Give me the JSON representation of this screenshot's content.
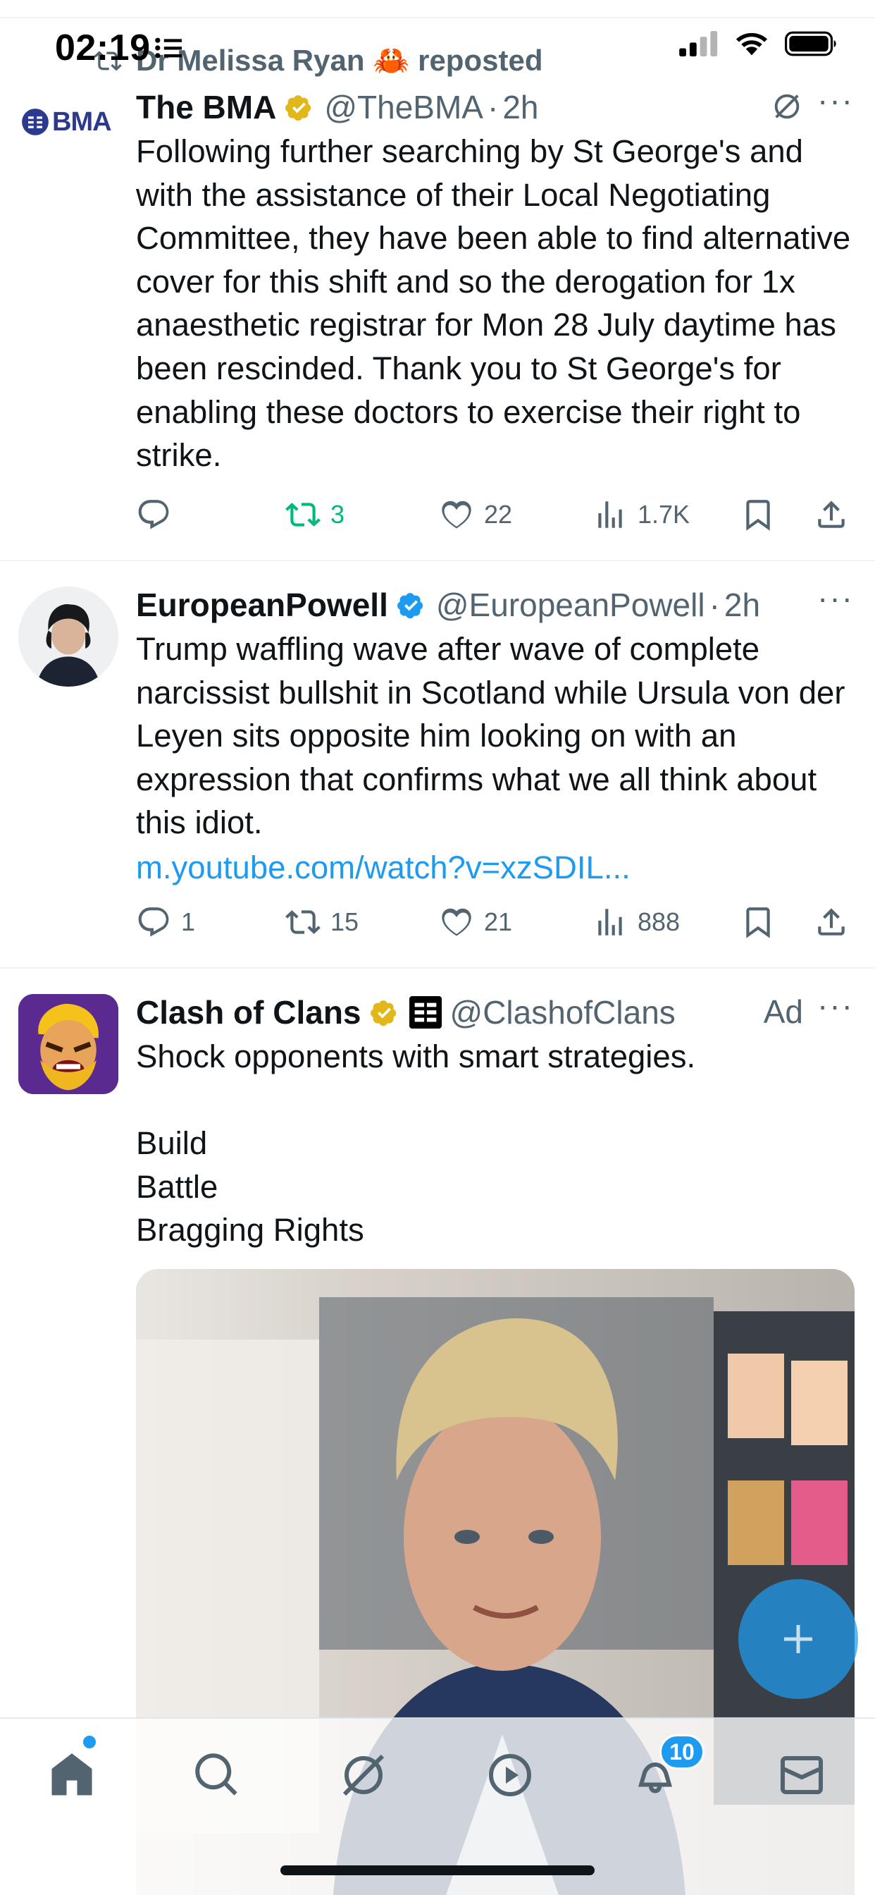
{
  "status": {
    "time": "02:19"
  },
  "colors": {
    "accent": "#1d9bf0",
    "repost_green": "#00ba7c",
    "secondary": "#536471",
    "gold": "#e2b719"
  },
  "tweets": [
    {
      "social_context": "Dr Melissa Ryan 🦀 reposted",
      "display_name": "The BMA",
      "handle": "@TheBMA",
      "time": "2h",
      "avatar_text": "BMA",
      "body": "Following further searching by St George's and with the assistance of their Local Negotiating Committee, they have been able to find alternative cover for this shift and so the derogation for 1x anaesthetic registrar for Mon 28 July daytime has been rescinded. Thank you to St George's for enabling these doctors to exercise their right to strike.",
      "stats": {
        "replies": "",
        "reposts": "3",
        "likes": "22",
        "views": "1.7K"
      }
    },
    {
      "display_name": "EuropeanPowell",
      "handle": "@EuropeanPowell",
      "time": "2h",
      "body": "Trump waffling wave after wave of complete narcissist bullshit in Scotland while Ursula von der Leyen sits opposite him looking on with an expression that confirms what we all think about this idiot.",
      "link": "m.youtube.com/watch?v=xzSDIL...",
      "stats": {
        "replies": "1",
        "reposts": "15",
        "likes": "21",
        "views": "888"
      }
    },
    {
      "display_name": "Clash of Clans",
      "handle": "@ClashofClans",
      "ad_label": "Ad",
      "body": "Shock opponents with smart strategies.\n\nBuild\nBattle\nBragging Rights"
    }
  ],
  "notifications_badge": "10",
  "icons": [
    "home-icon",
    "search-icon",
    "grok-icon",
    "video-icon",
    "bell-icon",
    "mail-icon",
    "compose-plus-icon"
  ]
}
